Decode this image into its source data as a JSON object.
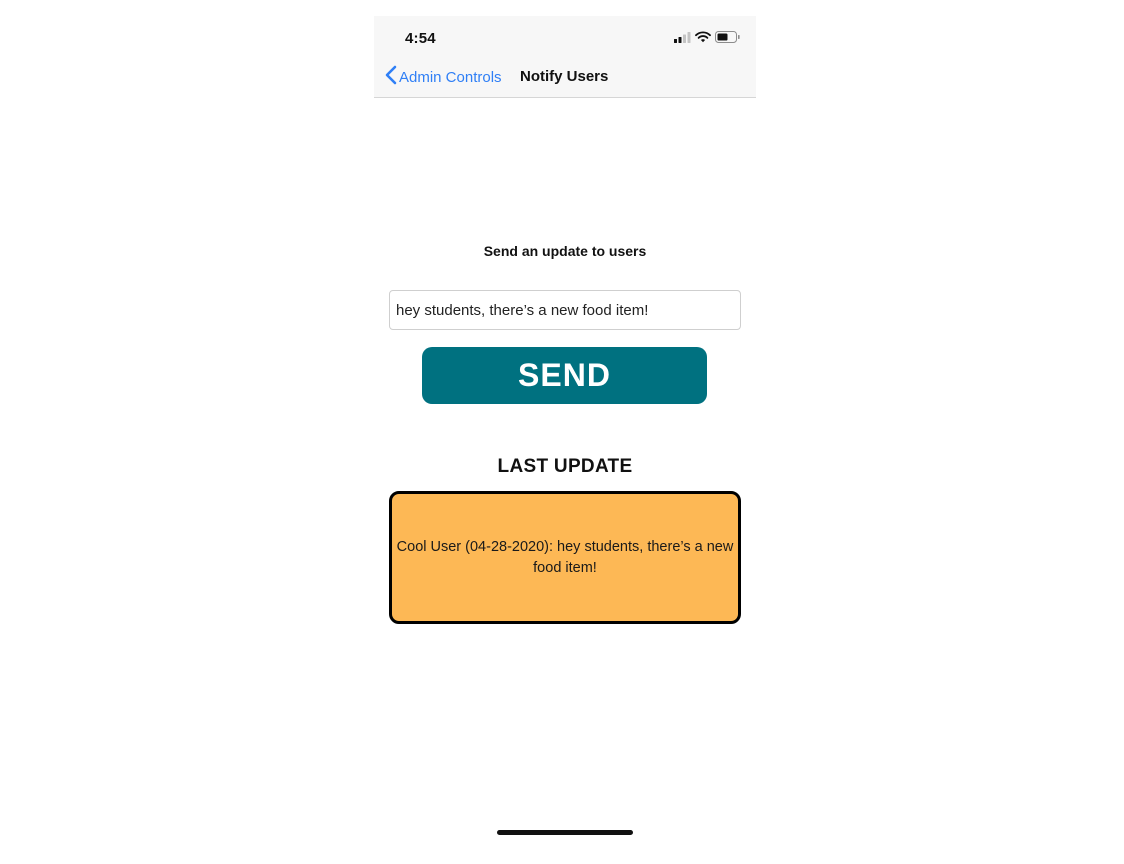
{
  "status_bar": {
    "time": "4:54",
    "icons": [
      "cellular-signal-icon",
      "wifi-icon",
      "battery-icon"
    ]
  },
  "nav": {
    "back_label": "Admin Controls",
    "title": "Notify Users"
  },
  "form": {
    "heading": "Send an update to users",
    "message_value": "hey students, there’s a new food item!",
    "send_label": "SEND"
  },
  "last_update": {
    "heading": "LAST UPDATE",
    "message": "Cool User (04-28-2020): hey students, there’s a new food item!"
  },
  "colors": {
    "accent_link": "#2f7ff6",
    "send_button": "#007180",
    "update_card": "#fdb855"
  }
}
